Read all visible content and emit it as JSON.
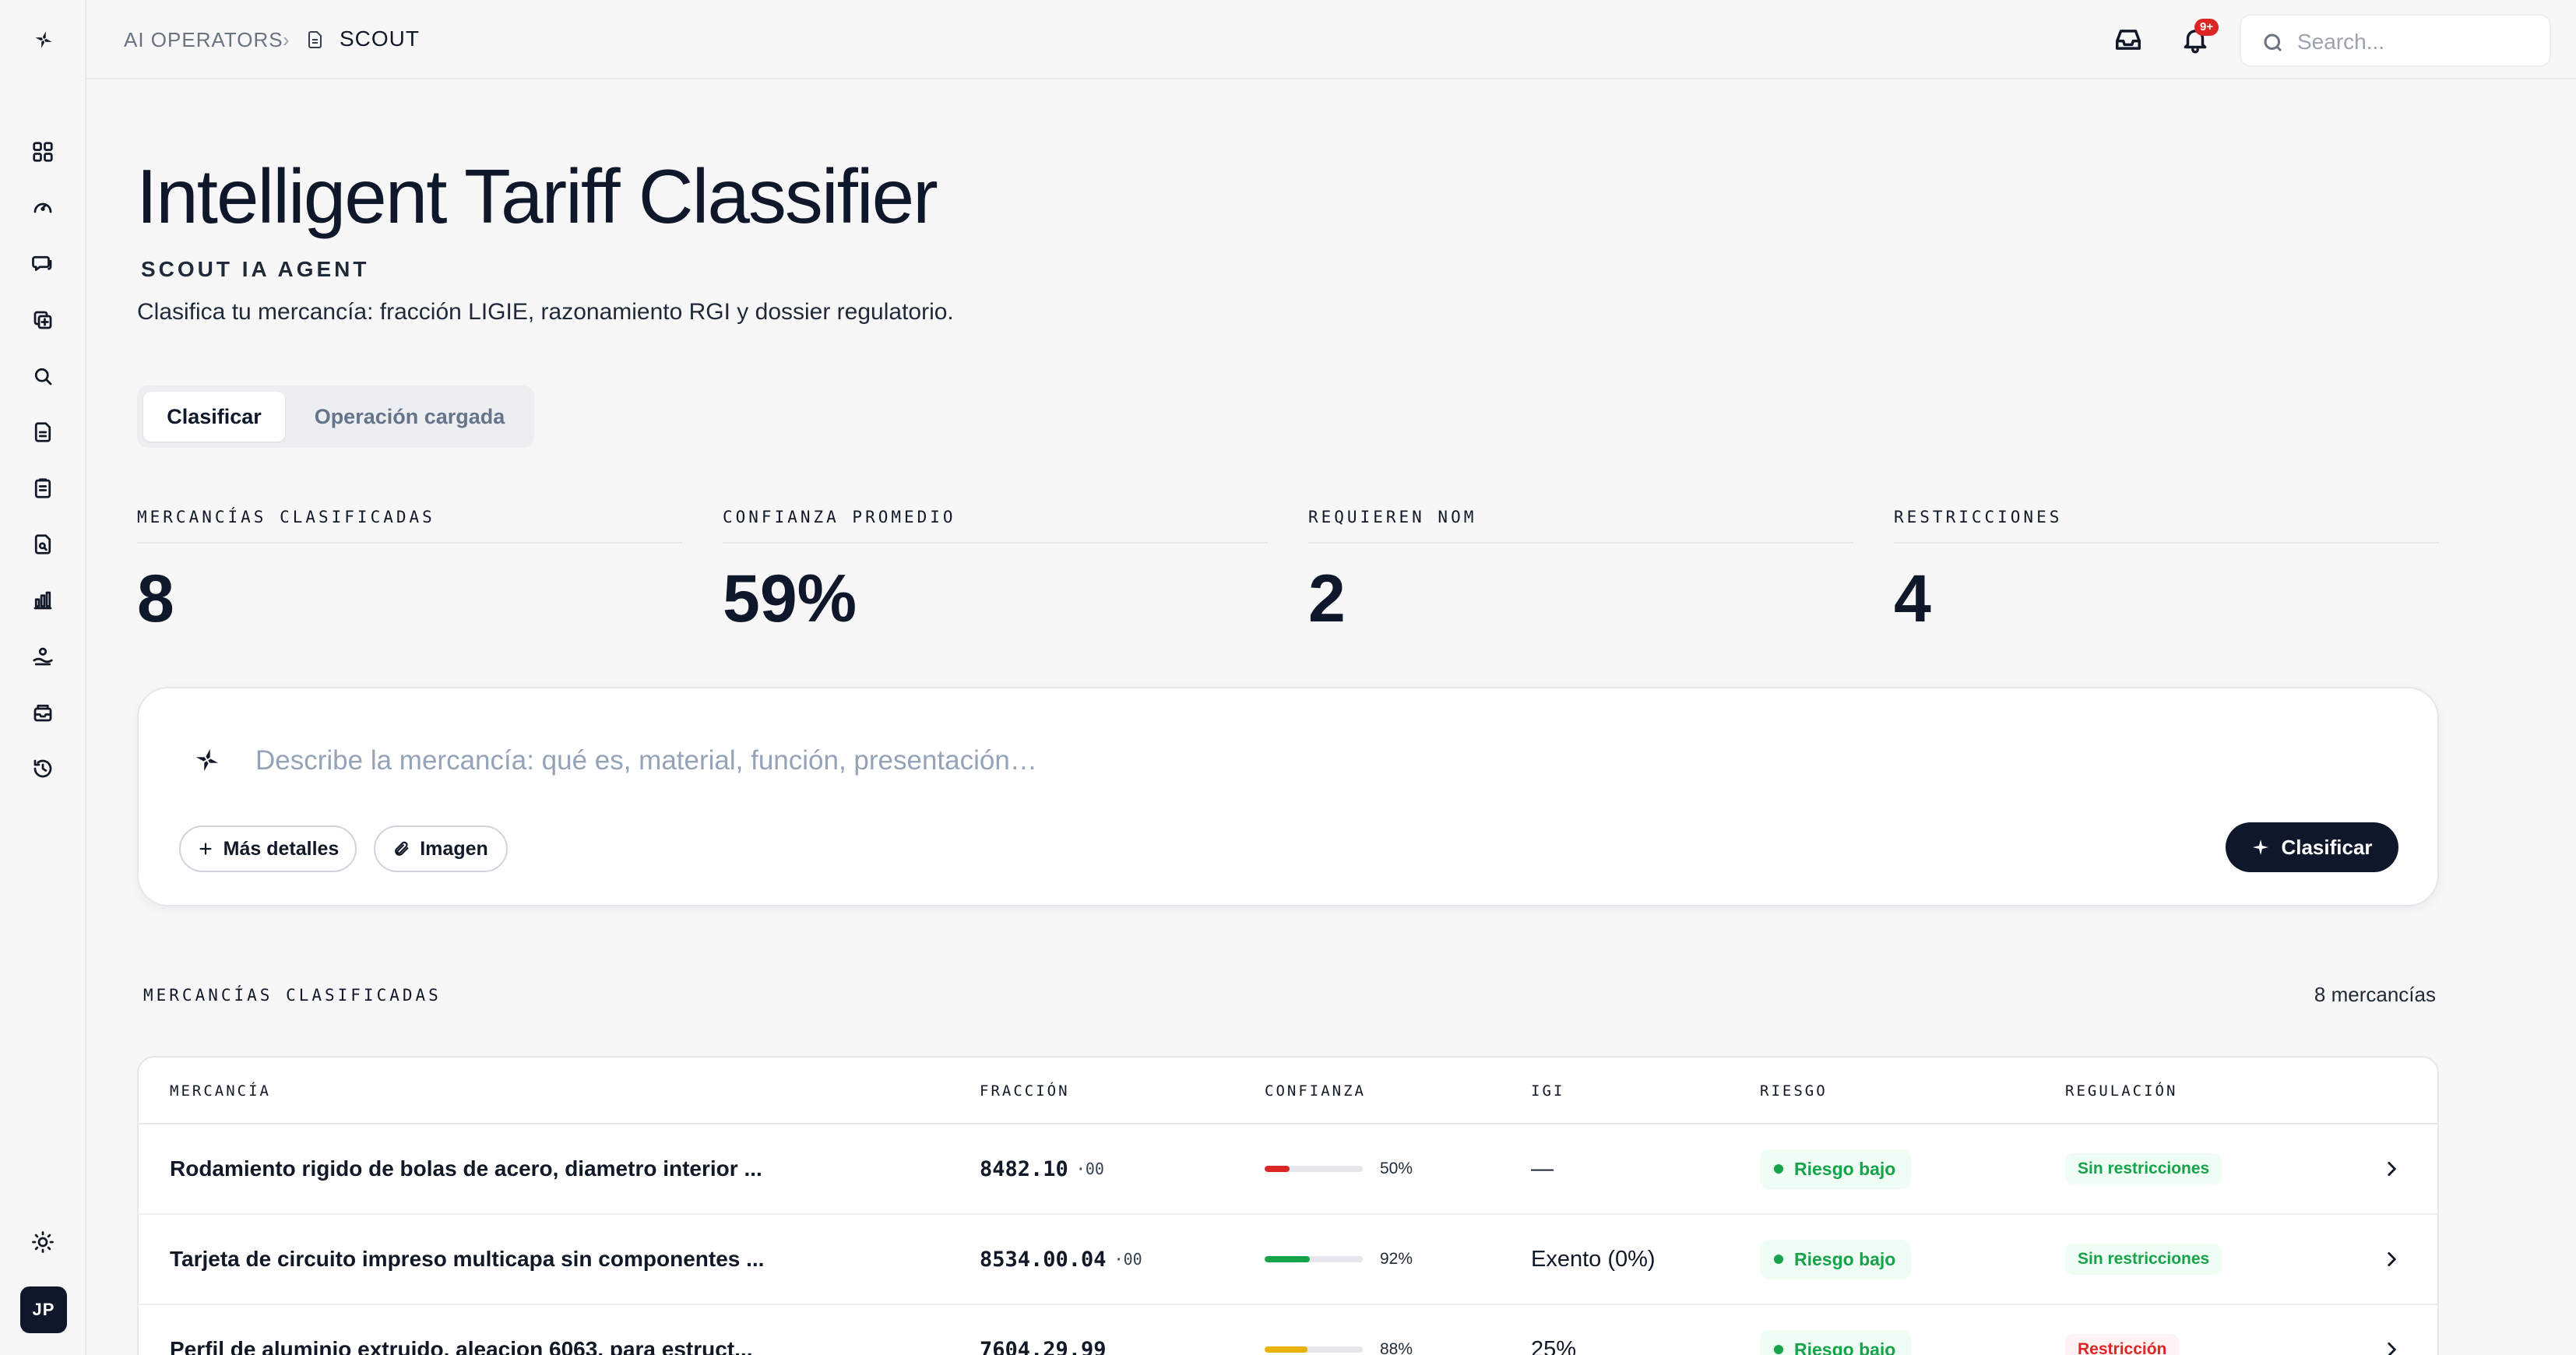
{
  "breadcrumb": {
    "root": "AI OPERATORS",
    "separator": "›",
    "current": "SCOUT"
  },
  "notifications": {
    "badge": "9+"
  },
  "search": {
    "placeholder": "Search..."
  },
  "header": {
    "title": "Intelligent Tariff Classifier",
    "subtitle": "SCOUT IA AGENT",
    "description": "Clasifica tu mercancía: fracción LIGIE, razonamiento RGI y dossier regulatorio."
  },
  "tabs": [
    {
      "label": "Clasificar",
      "active": true
    },
    {
      "label": "Operación cargada",
      "active": false
    }
  ],
  "stats": [
    {
      "label": "MERCANCÍAS CLASIFICADAS",
      "value": "8"
    },
    {
      "label": "CONFIANZA PROMEDIO",
      "value": "59%"
    },
    {
      "label": "REQUIEREN NOM",
      "value": "2"
    },
    {
      "label": "RESTRICCIONES",
      "value": "4"
    }
  ],
  "classify": {
    "placeholder": "Describe la mercancía: qué es, material, función, presentación…",
    "more_details": "Más detalles",
    "image": "Imagen",
    "submit": "Clasificar"
  },
  "list": {
    "title": "MERCANCÍAS CLASIFICADAS",
    "count": "8 mercancías",
    "columns": [
      "MERCANCÍA",
      "FRACCIÓN",
      "CONFIANZA",
      "IGI",
      "RIESGO",
      "REGULACIÓN"
    ],
    "rows": [
      {
        "name": "Rodamiento rigido de bolas de acero, diametro interior ...",
        "fraction": "8482.10",
        "nico": "·00",
        "confidence": 50,
        "confidence_label": "50%",
        "confidence_color": "#dc2626",
        "igi": "—",
        "risk": "Riesgo bajo",
        "regulation": "Sin restricciones",
        "reg_color": "#16a34a",
        "reg_bg": "#f0fdf4"
      },
      {
        "name": "Tarjeta de circuito impreso multicapa sin componentes ...",
        "fraction": "8534.00.04",
        "nico": "·00",
        "confidence": 92,
        "confidence_label": "92%",
        "confidence_color": "#16a34a",
        "igi": "Exento (0%)",
        "risk": "Riesgo bajo",
        "regulation": "Sin restricciones",
        "reg_color": "#16a34a",
        "reg_bg": "#f0fdf4"
      },
      {
        "name": "Perfil de aluminio extruido, aleacion 6063, para estruct...",
        "fraction": "7604.29.99",
        "nico": "",
        "confidence": 88,
        "confidence_label": "88%",
        "confidence_color": "#eab308",
        "igi": "25%",
        "risk": "Riesgo bajo",
        "regulation": "Restricción",
        "reg_color": "#dc2626",
        "reg_bg": "#fef2f2"
      }
    ]
  },
  "user": {
    "initials": "JP"
  }
}
